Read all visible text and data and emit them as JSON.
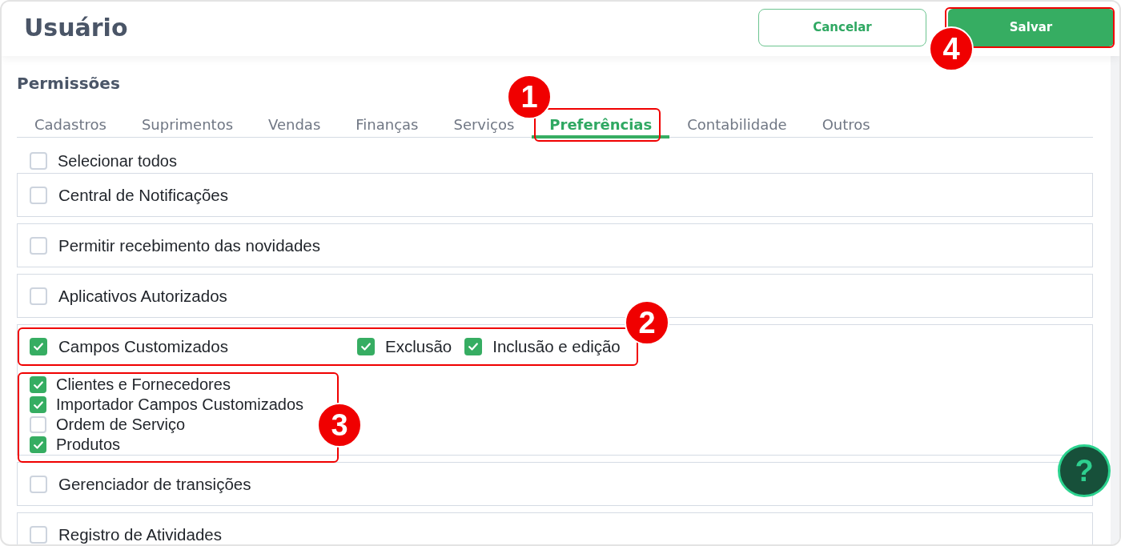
{
  "header": {
    "title": "Usuário",
    "buttons": [
      {
        "label": "Cancelar",
        "kind": "outline"
      },
      {
        "label": "Salvar",
        "kind": "primary"
      }
    ]
  },
  "section": {
    "title": "Permissões",
    "tabs": [
      {
        "label": "Cadastros",
        "selected": false
      },
      {
        "label": "Suprimentos",
        "selected": false
      },
      {
        "label": "Vendas",
        "selected": false
      },
      {
        "label": "Finanças",
        "selected": false
      },
      {
        "label": "Serviços",
        "selected": false
      },
      {
        "label": "Preferências",
        "selected": true
      },
      {
        "label": "Contabilidade",
        "selected": false
      },
      {
        "label": "Outros",
        "selected": false
      }
    ],
    "select_all": {
      "label": "Selecionar todos",
      "checked": false
    },
    "permissions": [
      {
        "label": "Central de Notificações",
        "checked": false
      },
      {
        "label": "Permitir recebimento das novidades",
        "checked": false
      },
      {
        "label": "Aplicativos Autorizados",
        "checked": false
      },
      {
        "label": "Campos Customizados",
        "checked": true,
        "options": [
          {
            "label": "Exclusão",
            "checked": true
          },
          {
            "label": "Inclusão e edição",
            "checked": true
          }
        ],
        "children": [
          {
            "label": "Clientes e Fornecedores",
            "checked": true
          },
          {
            "label": "Importador Campos Customizados",
            "checked": true
          },
          {
            "label": "Ordem de Serviço",
            "checked": false
          },
          {
            "label": "Produtos",
            "checked": true
          }
        ]
      },
      {
        "label": "Gerenciador de transições",
        "checked": false
      },
      {
        "label": "Registro de Atividades",
        "checked": false
      }
    ]
  },
  "help_button": {
    "label": "?"
  },
  "annotations": [
    {
      "label": "1"
    },
    {
      "label": "2"
    },
    {
      "label": "3"
    },
    {
      "label": "4"
    }
  ]
}
